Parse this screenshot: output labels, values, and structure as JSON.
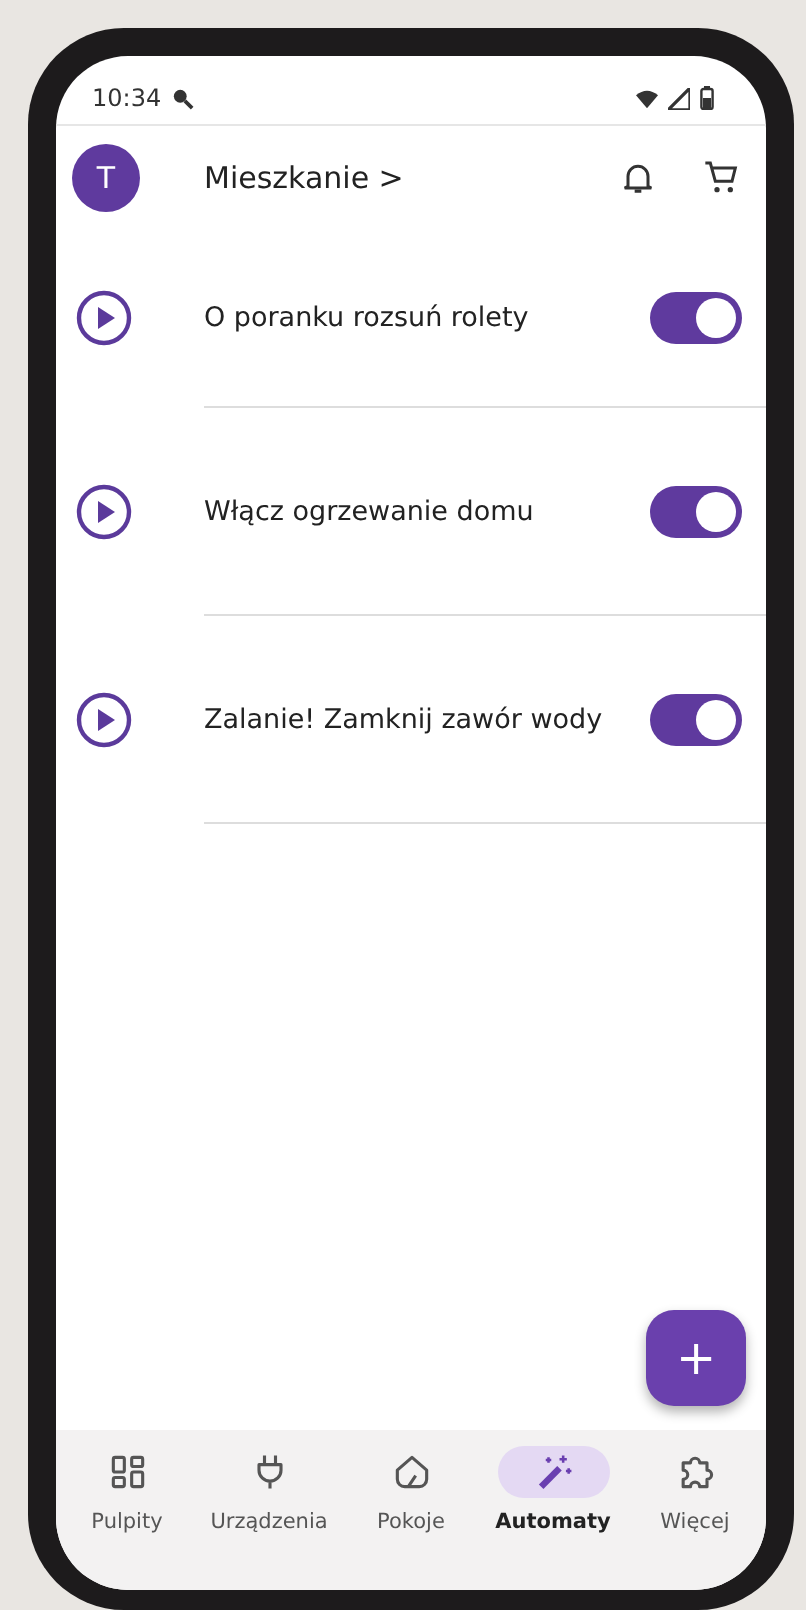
{
  "status_bar": {
    "time": "10:34"
  },
  "header": {
    "avatar": "T",
    "title": "Mieszkanie",
    "chevron": ">"
  },
  "automations": [
    {
      "name": "O poranku rozsuń rolety",
      "on": true
    },
    {
      "name": "Włącz ogrzewanie domu",
      "on": true
    },
    {
      "name": "Zalanie! Zamknij zawór wody",
      "on": true
    }
  ],
  "fab": {
    "label": "+"
  },
  "nav": [
    {
      "label": "Pulpity",
      "kind": "grid",
      "selected": false
    },
    {
      "label": "Urządzenia",
      "kind": "plug",
      "selected": false
    },
    {
      "label": "Pokoje",
      "kind": "house",
      "selected": false
    },
    {
      "label": "Automaty",
      "kind": "wand",
      "selected": true
    },
    {
      "label": "Więcej",
      "kind": "puzzle",
      "selected": false
    }
  ]
}
